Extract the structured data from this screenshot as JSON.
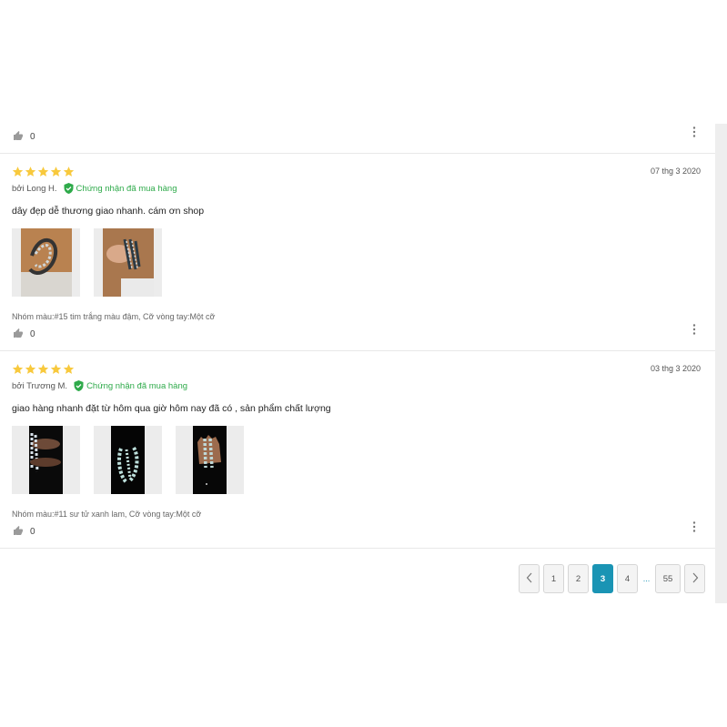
{
  "colors": {
    "star": "#f8c93d",
    "verified": "#2eaa4a",
    "accent": "#1a94b4"
  },
  "top_bar": {
    "like_count": "0",
    "like_icon": "thumbs-up-icon",
    "more_icon": "more-vertical-icon"
  },
  "reviews": [
    {
      "rating": 5,
      "date": "07 thg 3 2020",
      "author": "bởi Long H.",
      "verified_label": "Chứng nhận đã mua hàng",
      "text": "dây đẹp dễ thương giao nhanh. cám ơn shop",
      "photo_count": 2,
      "variant": "Nhóm màu:#15 tim trắng màu đậm, Cỡ vòng tay:Một cỡ",
      "like_count": "0"
    },
    {
      "rating": 5,
      "date": "03 thg 3 2020",
      "author": "bởi Trương M.",
      "verified_label": "Chứng nhận đã mua hàng",
      "text": "giao hàng nhanh đặt từ hôm qua giờ hôm nay đã có , sản phẩm chất lượng",
      "photo_count": 3,
      "variant": "Nhóm màu:#11 sư tử xanh lam, Cỡ vòng tay:Một cỡ",
      "like_count": "0"
    }
  ],
  "pagination": {
    "pages": [
      "1",
      "2",
      "3",
      "4",
      "55"
    ],
    "current": "3",
    "ellipsis": "...",
    "prev_icon": "chevron-left-icon",
    "next_icon": "chevron-right-icon"
  }
}
